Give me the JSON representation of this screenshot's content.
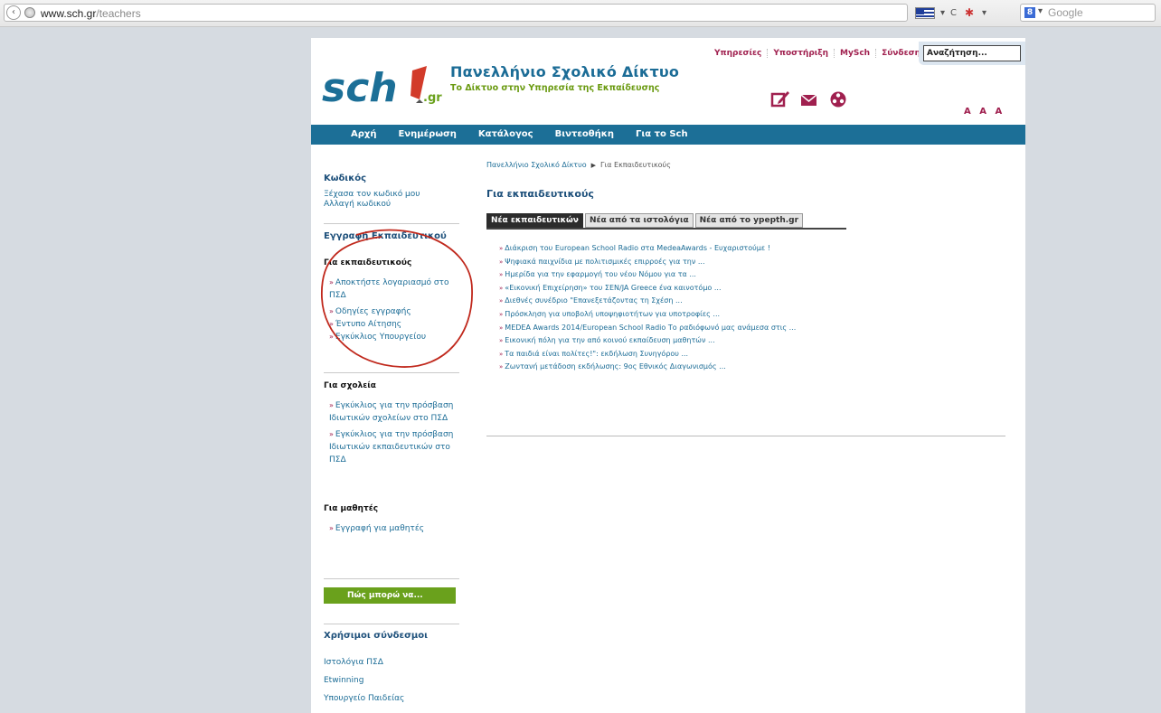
{
  "browser": {
    "url_domain": "www.sch.gr",
    "url_path": "/teachers",
    "search_engine_placeholder": "Google",
    "reload_glyph": "C",
    "caret_glyph": "▾",
    "back_glyph": "‹",
    "engine_letter": "8"
  },
  "header": {
    "site_title": "Πανελλήνιο Σχολικό Δίκτυο",
    "site_subtitle": "Το Δίκτυο στην Υπηρεσία της Εκπαίδευσης",
    "logo_text": "sch",
    "logo_suffix": ".gr",
    "top_links": [
      "Υπηρεσίες",
      "Υποστήριξη",
      "MySch",
      "Σύνδεση"
    ],
    "search_value": "Αναζήτηση...",
    "font_size_control": "A A A"
  },
  "nav": {
    "items": [
      "Αρχή",
      "Ενημέρωση",
      "Κατάλογος",
      "Βιντεοθήκη",
      "Για το Sch"
    ]
  },
  "sidebar": {
    "code_heading": "Κωδικός",
    "code_links": [
      "Ξέχασα τον κωδικό μου",
      "Αλλαγή κωδικού"
    ],
    "teacher_reg_heading": "Εγγραφή Εκπαιδευτικού",
    "for_teachers_heading": "Για εκπαιδευτικούς",
    "teacher_links": [
      "Αποκτήστε λογαριασμό στο ΠΣΔ",
      "Οδηγίες εγγραφής",
      "Έντυπο Αίτησης",
      "Εγκύκλιος Υπουργείου"
    ],
    "for_schools_heading": "Για σχολεία",
    "school_links": [
      "Εγκύκλιος για την πρόσβαση Ιδιωτικών σχολείων στο ΠΣΔ",
      "Εγκύκλιος για την πρόσβαση Ιδιωτικών εκπαιδευτικών στο ΠΣΔ"
    ],
    "for_students_heading": "Για μαθητές",
    "student_links": [
      "Εγγραφή για μαθητές"
    ],
    "how_to_button": "Πώς μπορώ να...",
    "useful_links_heading": "Χρήσιμοι σύνδεσμοι",
    "useful_links": [
      "Ιστολόγια ΠΣΔ",
      "Etwinning",
      "Υπουργείο Παιδείας"
    ]
  },
  "main": {
    "breadcrumb_home": "Πανελλήνιο Σχολικό Δίκτυο",
    "breadcrumb_current": "Για Εκπαιδευτικούς",
    "title": "Για εκπαιδευτικούς",
    "tabs": [
      "Νέα εκπαιδευτικών",
      "Νέα από τα ιστολόγια",
      "Νέα από το ypepth.gr"
    ],
    "news": [
      "Διάκριση του European School Radio στα MedeaAwards - Ευχαριστούμε !",
      "Ψηφιακά παιχνίδια με πολιτισμικές επιρροές για την ...",
      "Ημερίδα για την εφαρμογή του νέου Νόμου για τα ...",
      "«Εικονική Επιχείρηση» του ΣΕΝ/JA Greece ένα καινοτόμο ...",
      "Διεθνές συνέδριο \"Επανεξετάζοντας τη Σχέση ...",
      "Πρόσκληση για υποβολή υποψηφιοτήτων για υποτροφίες ...",
      "MEDEA Awards 2014/European School Radio Το ραδιόφωνό μας ανάμεσα στις ...",
      "Εικονική πόλη για την από κοινού εκπαίδευση μαθητών ...",
      "Τα παιδιά είναι πολίτες!\": εκδήλωση Συνηγόρου ...",
      "Ζωντανή μετάδοση εκδήλωσης: 9ος Εθνικός Διαγωνισμός ..."
    ]
  },
  "colors": {
    "brand_blue": "#1c6f97",
    "brand_green": "#6aa11c",
    "accent_magenta": "#a0204f",
    "annotation_red": "#c0281c"
  }
}
